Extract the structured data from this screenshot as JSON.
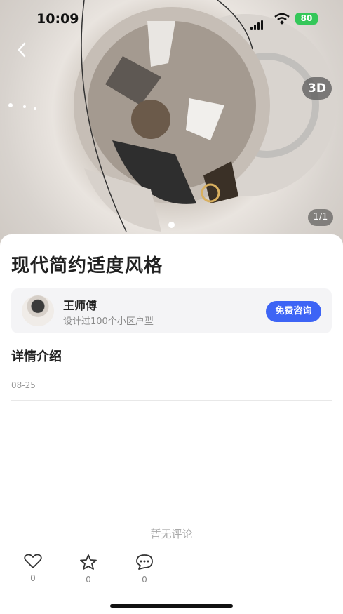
{
  "status_bar": {
    "time": "10:09",
    "battery": "80"
  },
  "hero": {
    "badge_3d": "3D",
    "page_indicator": "1/1",
    "image": "panorama-interior-icon"
  },
  "detail": {
    "title": "现代简约适度风格",
    "designer": {
      "name": "王师傅",
      "description": "设计过100个小区户型",
      "consult_button": "免费咨询"
    },
    "section_title": "详情介绍",
    "date": "08-25"
  },
  "comments": {
    "empty_text": "暂无评论"
  },
  "actions": [
    {
      "name": "like",
      "icon": "heart-icon",
      "count": "0"
    },
    {
      "name": "favorite",
      "icon": "star-icon",
      "count": "0"
    },
    {
      "name": "comment",
      "icon": "comment-icon",
      "count": "0"
    }
  ],
  "colors": {
    "accent": "#3d64f5",
    "battery": "#34c759"
  }
}
